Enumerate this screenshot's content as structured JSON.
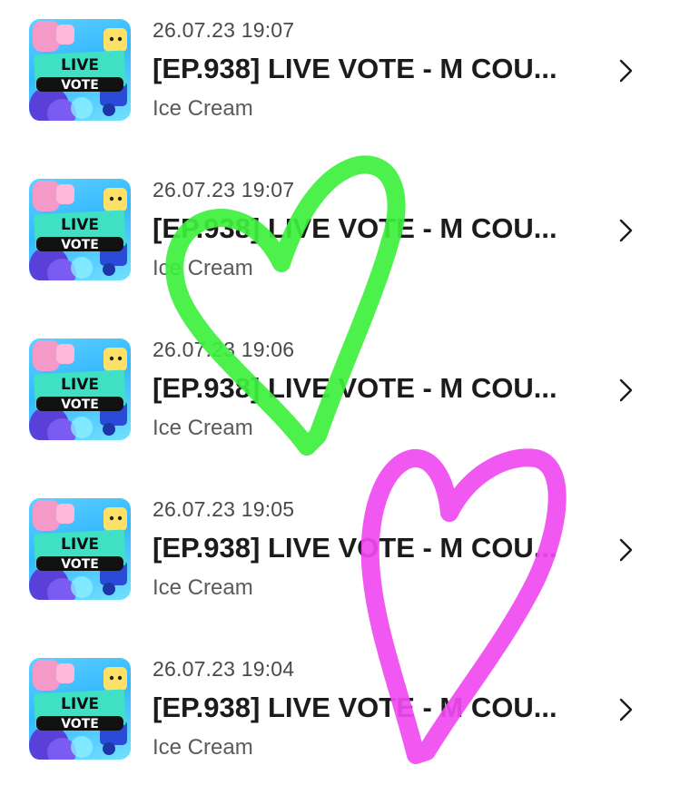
{
  "items": [
    {
      "date": "26.07.23 19:07",
      "title": "[EP.938] LIVE VOTE - M COU...",
      "subtitle": "Ice Cream",
      "thumb": {
        "line1": "LIVE",
        "line2": "VOTE"
      }
    },
    {
      "date": "26.07.23 19:07",
      "title": "[EP.938] LIVE VOTE - M COU...",
      "subtitle": "Ice Cream",
      "thumb": {
        "line1": "LIVE",
        "line2": "VOTE"
      }
    },
    {
      "date": "26.07.23 19:06",
      "title": "[EP.938] LIVE VOTE - M COU...",
      "subtitle": "Ice Cream",
      "thumb": {
        "line1": "LIVE",
        "line2": "VOTE"
      }
    },
    {
      "date": "26.07.23 19:05",
      "title": "[EP.938] LIVE VOTE - M COU...",
      "subtitle": "Ice Cream",
      "thumb": {
        "line1": "LIVE",
        "line2": "VOTE"
      }
    },
    {
      "date": "26.07.23 19:04",
      "title": "[EP.938] LIVE VOTE - M COU...",
      "subtitle": "Ice Cream",
      "thumb": {
        "line1": "LIVE",
        "line2": "VOTE"
      }
    }
  ],
  "icons": {
    "row_arrow": "chevron-right-icon"
  },
  "colors": {
    "title_text": "#1b1b1b",
    "meta_text": "#5a5a5a",
    "thumb_banner": "#111111",
    "thumb_teal": "#3fe0c4",
    "green_heart": "#3df03d",
    "pink_heart": "#f04af0"
  }
}
